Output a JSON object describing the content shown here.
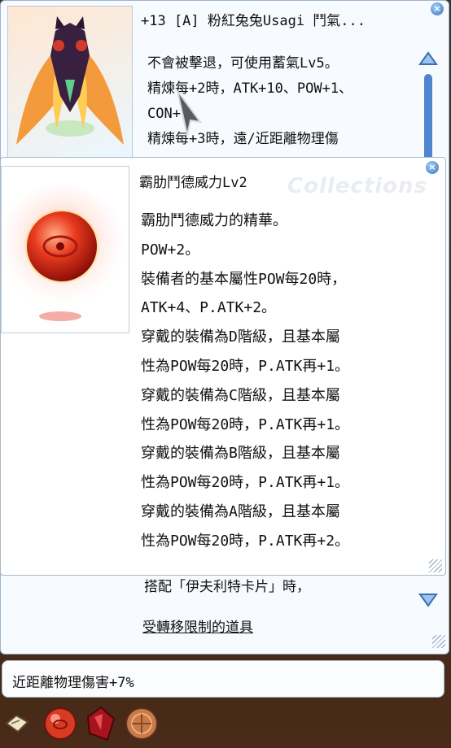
{
  "item_window": {
    "title": "+13 [A] 粉紅兔兔Usagi 鬥氣...",
    "close_symbol": "×",
    "description_lines": [
      "不會被擊退，可使用蓄氣Lv5。",
      "精煉每+2時，ATK+10、POW+1、",
      "CON+1。",
      "精煉每+3時，遠/近距離物理傷"
    ],
    "lower_lines": [
      "搭配「伊夫利特卡片」時，",
      "受轉移限制的道具"
    ]
  },
  "card_tooltip": {
    "title": "霸肋鬥德威力Lv2",
    "watermark": "Collections",
    "close_symbol": "×",
    "description_lines": [
      "霸肋鬥德威力的精華。",
      "POW+2。",
      "裝備者的基本屬性POW每20時，",
      "ATK+4、P.ATK+2。",
      "穿戴的裝備為D階級，且基本屬",
      "性為POW每20時，P.ATK再+1。",
      "穿戴的裝備為C階級，且基本屬",
      "性為POW每20時，P.ATK再+1。",
      "穿戴的裝備為B階級，且基本屬",
      "性為POW每20時，P.ATK再+1。",
      "穿戴的裝備為A階級，且基本屬",
      "性為POW每20時，P.ATK再+2。"
    ]
  },
  "info_bar": {
    "text": "近距離物理傷害+7%"
  },
  "slots": [
    "map-icon",
    "red-orb-icon",
    "red-crystal-icon",
    "bronze-coin-icon"
  ],
  "colors": {
    "window_border": "#9fb3c8",
    "scroll_blue": "#4d86cf",
    "close_blue": "#3b72b8"
  }
}
